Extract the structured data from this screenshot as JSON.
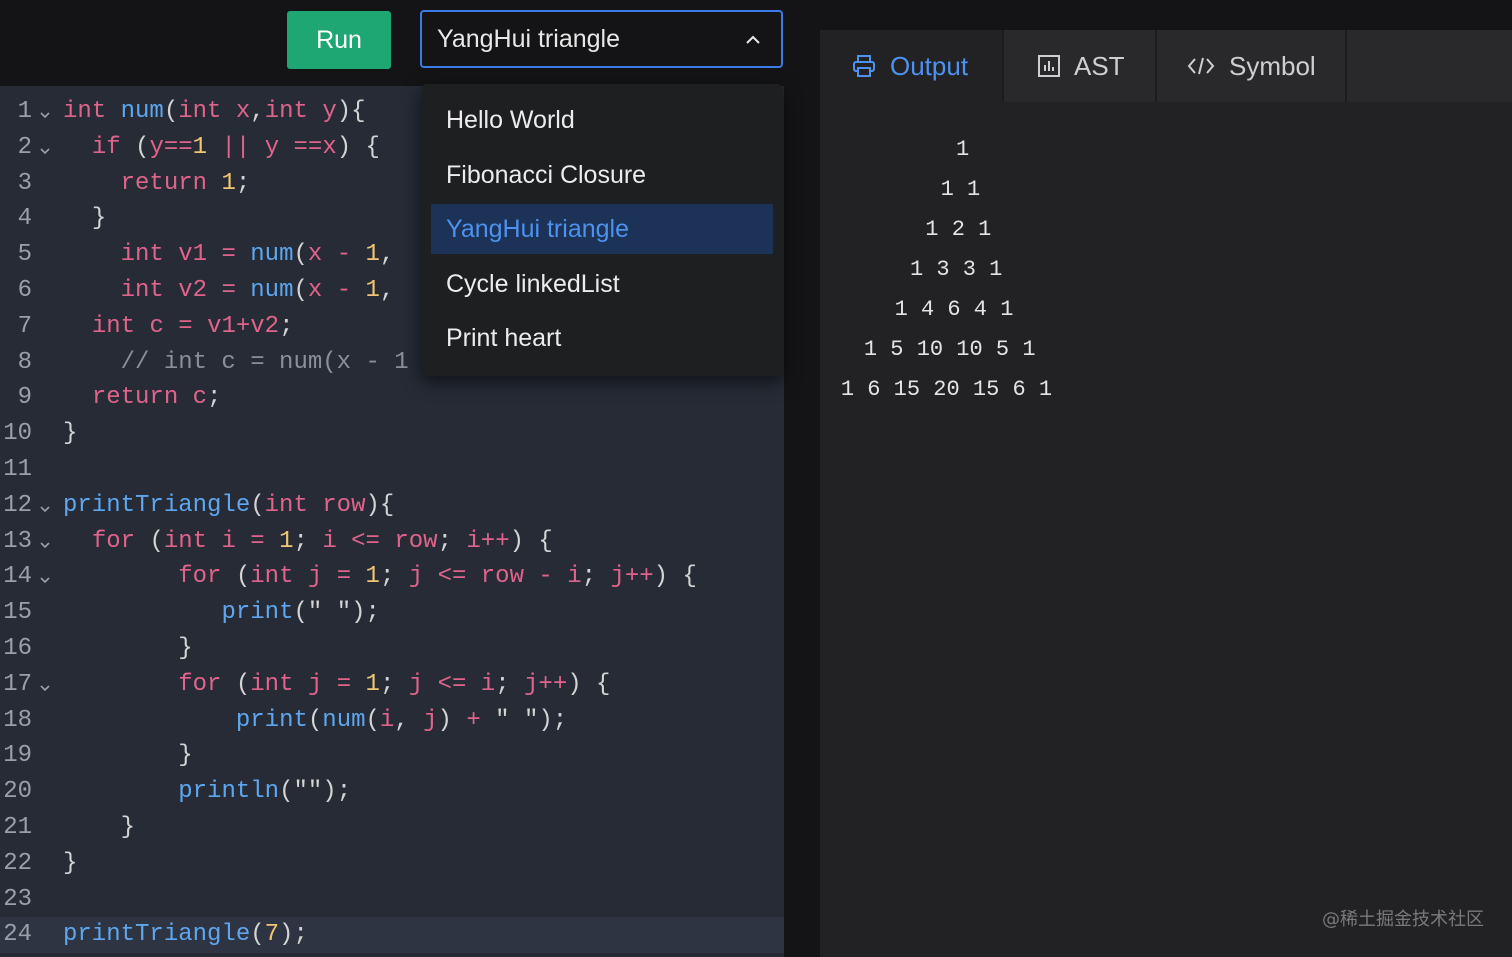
{
  "toolbar": {
    "run_label": "Run",
    "selected_example": "YangHui triangle"
  },
  "dropdown": {
    "options": [
      "Hello World",
      "Fibonacci Closure",
      "YangHui triangle",
      "Cycle linkedList",
      "Print heart"
    ],
    "selected_index": 2
  },
  "editor": {
    "lines": [
      {
        "n": "1",
        "fold": true,
        "code": "int num(int x,int y){"
      },
      {
        "n": "2",
        "fold": true,
        "code": "  if (y==1 || y ==x) {"
      },
      {
        "n": "3",
        "fold": false,
        "code": "    return 1;"
      },
      {
        "n": "4",
        "fold": false,
        "code": "  }"
      },
      {
        "n": "5",
        "fold": false,
        "code": "    int v1 = num(x - 1,"
      },
      {
        "n": "6",
        "fold": false,
        "code": "    int v2 = num(x - 1,"
      },
      {
        "n": "7",
        "fold": false,
        "code": "  int c = v1+v2;"
      },
      {
        "n": "8",
        "fold": false,
        "code": "    // int c = num(x - 1"
      },
      {
        "n": "9",
        "fold": false,
        "code": "  return c;"
      },
      {
        "n": "10",
        "fold": false,
        "code": "}"
      },
      {
        "n": "11",
        "fold": false,
        "code": ""
      },
      {
        "n": "12",
        "fold": true,
        "code": "printTriangle(int row){"
      },
      {
        "n": "13",
        "fold": true,
        "code": "  for (int i = 1; i <= row; i++) {"
      },
      {
        "n": "14",
        "fold": true,
        "code": "        for (int j = 1; j <= row - i; j++) {"
      },
      {
        "n": "15",
        "fold": false,
        "code": "           print(\" \");"
      },
      {
        "n": "16",
        "fold": false,
        "code": "        }"
      },
      {
        "n": "17",
        "fold": true,
        "code": "        for (int j = 1; j <= i; j++) {"
      },
      {
        "n": "18",
        "fold": false,
        "code": "            print(num(i, j) + \" \");"
      },
      {
        "n": "19",
        "fold": false,
        "code": "        }"
      },
      {
        "n": "20",
        "fold": false,
        "code": "        println(\"\");"
      },
      {
        "n": "21",
        "fold": false,
        "code": "    }"
      },
      {
        "n": "22",
        "fold": false,
        "code": "}"
      },
      {
        "n": "23",
        "fold": false,
        "code": ""
      },
      {
        "n": "24",
        "fold": false,
        "code": "printTriangle(7);"
      }
    ],
    "active_line": 24
  },
  "tabs": [
    {
      "label": "Output",
      "icon": "printer-icon",
      "active": true
    },
    {
      "label": "AST",
      "icon": "chart-icon",
      "active": false
    },
    {
      "label": "Symbol",
      "icon": "code-icon",
      "active": false
    }
  ],
  "output": {
    "rows": [
      "1",
      "1 1",
      "1 2 1",
      "1 3 3 1",
      "1 4 6 4 1",
      "1 5 10 10 5 1",
      "1 6 15 20 15 6 1"
    ]
  },
  "watermark": "@稀土掘金技术社区",
  "colors": {
    "accent": "#4c92ee",
    "run_button": "#1fa773",
    "editor_bg": "#262b36",
    "keyword": "#e0648a",
    "function": "#5ea7f0",
    "number": "#f0c674"
  }
}
